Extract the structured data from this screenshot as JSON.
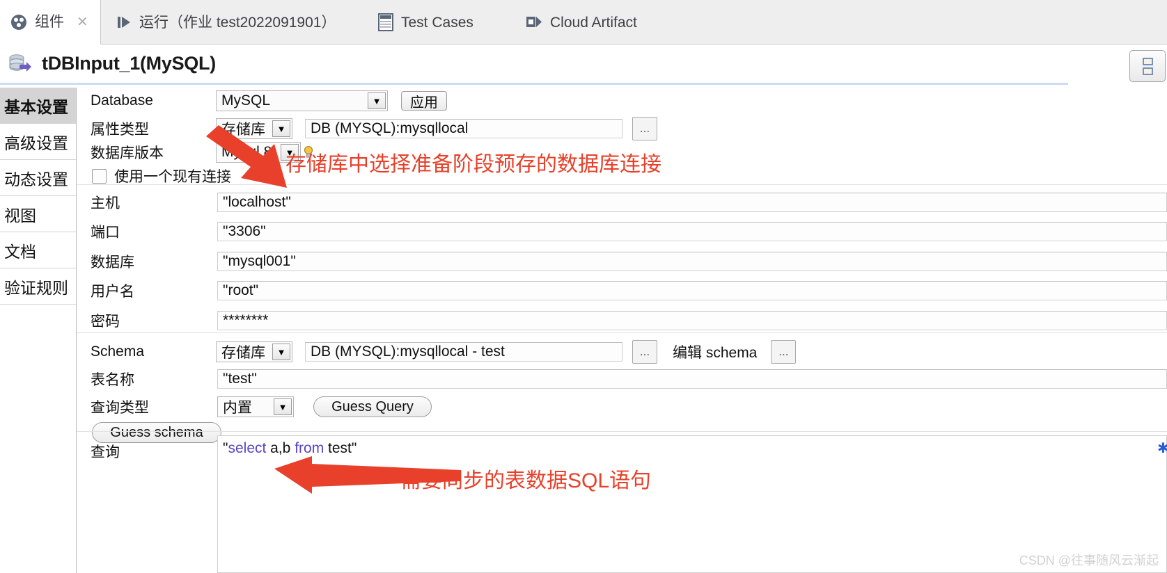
{
  "tabs": [
    {
      "label": "组件",
      "icon": "component-icon",
      "active": true,
      "closable": true
    },
    {
      "label": "运行（作业 test2022091901）",
      "icon": "run-icon",
      "active": false,
      "closable": false
    },
    {
      "label": "Test Cases",
      "icon": "test-cases-icon",
      "active": false,
      "closable": false
    },
    {
      "label": "Cloud Artifact",
      "icon": "cloud-artifact-icon",
      "active": false,
      "closable": false
    }
  ],
  "header": {
    "title": "tDBInput_1(MySQL)",
    "icon": "database-component-icon"
  },
  "sidebar": {
    "items": [
      {
        "label": "基本设置",
        "active": true
      },
      {
        "label": "高级设置",
        "active": false
      },
      {
        "label": "动态设置",
        "active": false
      },
      {
        "label": "视图",
        "active": false
      },
      {
        "label": "文档",
        "active": false
      },
      {
        "label": "验证规则",
        "active": false
      }
    ]
  },
  "form": {
    "database": {
      "label": "Database",
      "value": "MySQL",
      "apply_button": "应用"
    },
    "property_type": {
      "label": "属性类型",
      "value": "存储库",
      "repository_value": "DB (MYSQL):mysqllocal",
      "browse_button": "..."
    },
    "db_version": {
      "label": "数据库版本",
      "value": "Mysql 8"
    },
    "use_existing_connection": {
      "label": "使用一个现有连接",
      "checked": false
    },
    "host": {
      "label": "主机",
      "value": "\"localhost\""
    },
    "port": {
      "label": "端口",
      "value": "\"3306\""
    },
    "db_name": {
      "label": "数据库",
      "value": "\"mysql001\""
    },
    "username": {
      "label": "用户名",
      "value": "\"root\""
    },
    "password": {
      "label": "密码",
      "value": "********"
    },
    "schema": {
      "label": "Schema",
      "value": "存储库",
      "repository_value": "DB (MYSQL):mysqllocal - test",
      "browse_button": "...",
      "edit_label": "编辑 schema",
      "edit_browse_button": "..."
    },
    "table_name": {
      "label": "表名称",
      "value": "\"test\""
    },
    "query_type": {
      "label": "查询类型",
      "value": "内置",
      "guess_query_button": "Guess Query"
    },
    "guess_schema_button": "Guess schema",
    "query": {
      "label": "查询",
      "prefix": "\"",
      "kw1": "select",
      "mid": " a,b ",
      "kw2": "from",
      "suffix": " test\"",
      "full_value": "\"select a,b from test\""
    }
  },
  "annotations": [
    {
      "name": "repository-annotation",
      "text": "存储库中选择准备阶段预存的数据库连接"
    },
    {
      "name": "sql-annotation",
      "text": "需要同步的表数据SQL语句"
    }
  ],
  "watermark": "CSDN @往事随风云渐起",
  "colors": {
    "annotation_red": "#e8402a",
    "sql_keyword": "#5a43c8",
    "selected_tab_bg": "#d4d4d4",
    "title_underline": "#cddcf0"
  }
}
